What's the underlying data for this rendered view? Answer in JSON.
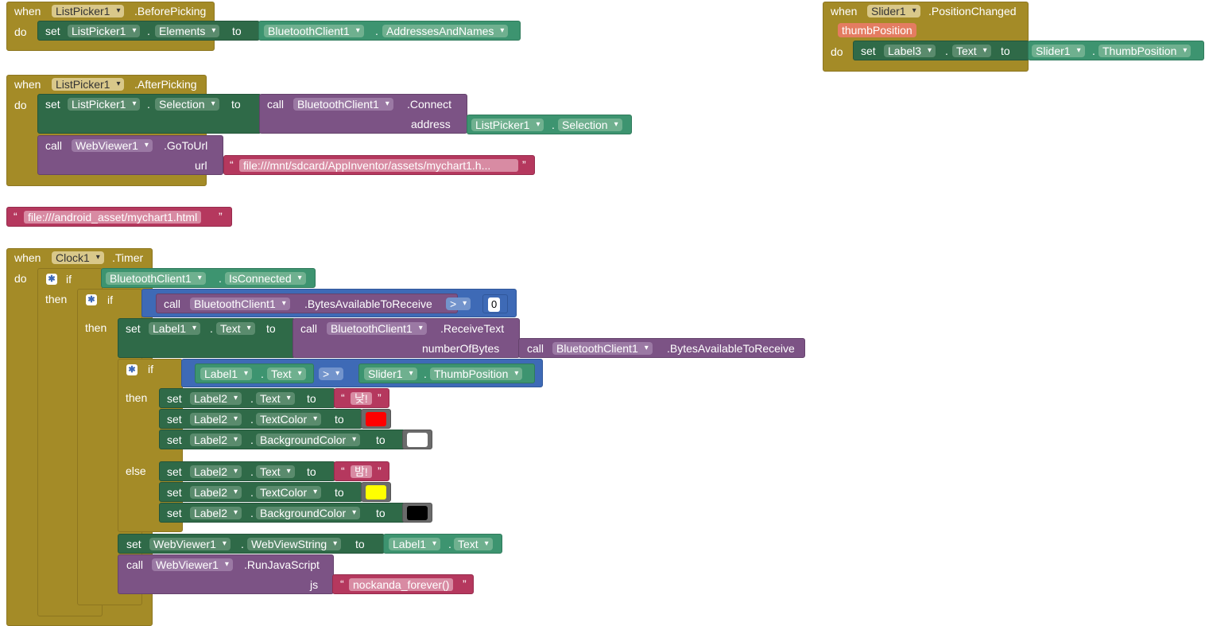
{
  "kw": {
    "when": "when",
    "do": "do",
    "set": "set",
    "to": "to",
    "call": "call",
    "if": "if",
    "then": "then",
    "else": "else",
    "dot": "."
  },
  "b1": {
    "component": "ListPicker1",
    "event": ".BeforePicking",
    "set_comp": "ListPicker1",
    "set_prop": "Elements",
    "val_comp": "BluetoothClient1",
    "val_prop": "AddressesAndNames"
  },
  "b2": {
    "component": "ListPicker1",
    "event": ".AfterPicking",
    "set_comp": "ListPicker1",
    "set_prop": "Selection",
    "call_comp": "BluetoothClient1",
    "call_method": ".Connect",
    "arg_name": "address",
    "arg_comp": "ListPicker1",
    "arg_prop": "Selection",
    "call2_comp": "WebViewer1",
    "call2_method": ".GoToUrl",
    "arg2_name": "url",
    "arg2_text": "file:///mnt/sdcard/AppInventor/assets/mychart1.h..."
  },
  "b3": {
    "text": "file:///android_asset/mychart1.html"
  },
  "b4": {
    "component": "Slider1",
    "event": ".PositionChanged",
    "param": "thumbPosition",
    "set_comp": "Label3",
    "set_prop": "Text",
    "val_comp": "Slider1",
    "val_prop": "ThumbPosition"
  },
  "b5": {
    "component": "Clock1",
    "event": ".Timer",
    "if1_comp": "BluetoothClient1",
    "if1_prop": "IsConnected",
    "if2_call_comp": "BluetoothClient1",
    "if2_call_method": ".BytesAvailableToReceive",
    "if2_op": ">",
    "if2_num": "0",
    "set1_comp": "Label1",
    "set1_prop": "Text",
    "set1_call_comp": "BluetoothClient1",
    "set1_call_method": ".ReceiveText",
    "set1_arg": "numberOfBytes",
    "set1_arg_comp": "BluetoothClient1",
    "set1_arg_method": ".BytesAvailableToReceive",
    "if3_a_comp": "Label1",
    "if3_a_prop": "Text",
    "if3_op": ">",
    "if3_b_comp": "Slider1",
    "if3_b_prop": "ThumbPosition",
    "then_rows": [
      {
        "comp": "Label2",
        "prop": "Text",
        "text": "낮!"
      },
      {
        "comp": "Label2",
        "prop": "TextColor",
        "color": "#ff0000"
      },
      {
        "comp": "Label2",
        "prop": "BackgroundColor",
        "color": "#ffffff"
      }
    ],
    "else_rows": [
      {
        "comp": "Label2",
        "prop": "Text",
        "text": "밤!"
      },
      {
        "comp": "Label2",
        "prop": "TextColor",
        "color": "#ffff00"
      },
      {
        "comp": "Label2",
        "prop": "BackgroundColor",
        "color": "#000000"
      }
    ],
    "set2_comp": "WebViewer1",
    "set2_prop": "WebViewString",
    "set2_val_comp": "Label1",
    "set2_val_prop": "Text",
    "call_comp": "WebViewer1",
    "call_method": ".RunJavaScript",
    "call_arg": "js",
    "call_text": "nockanda_forever()"
  }
}
